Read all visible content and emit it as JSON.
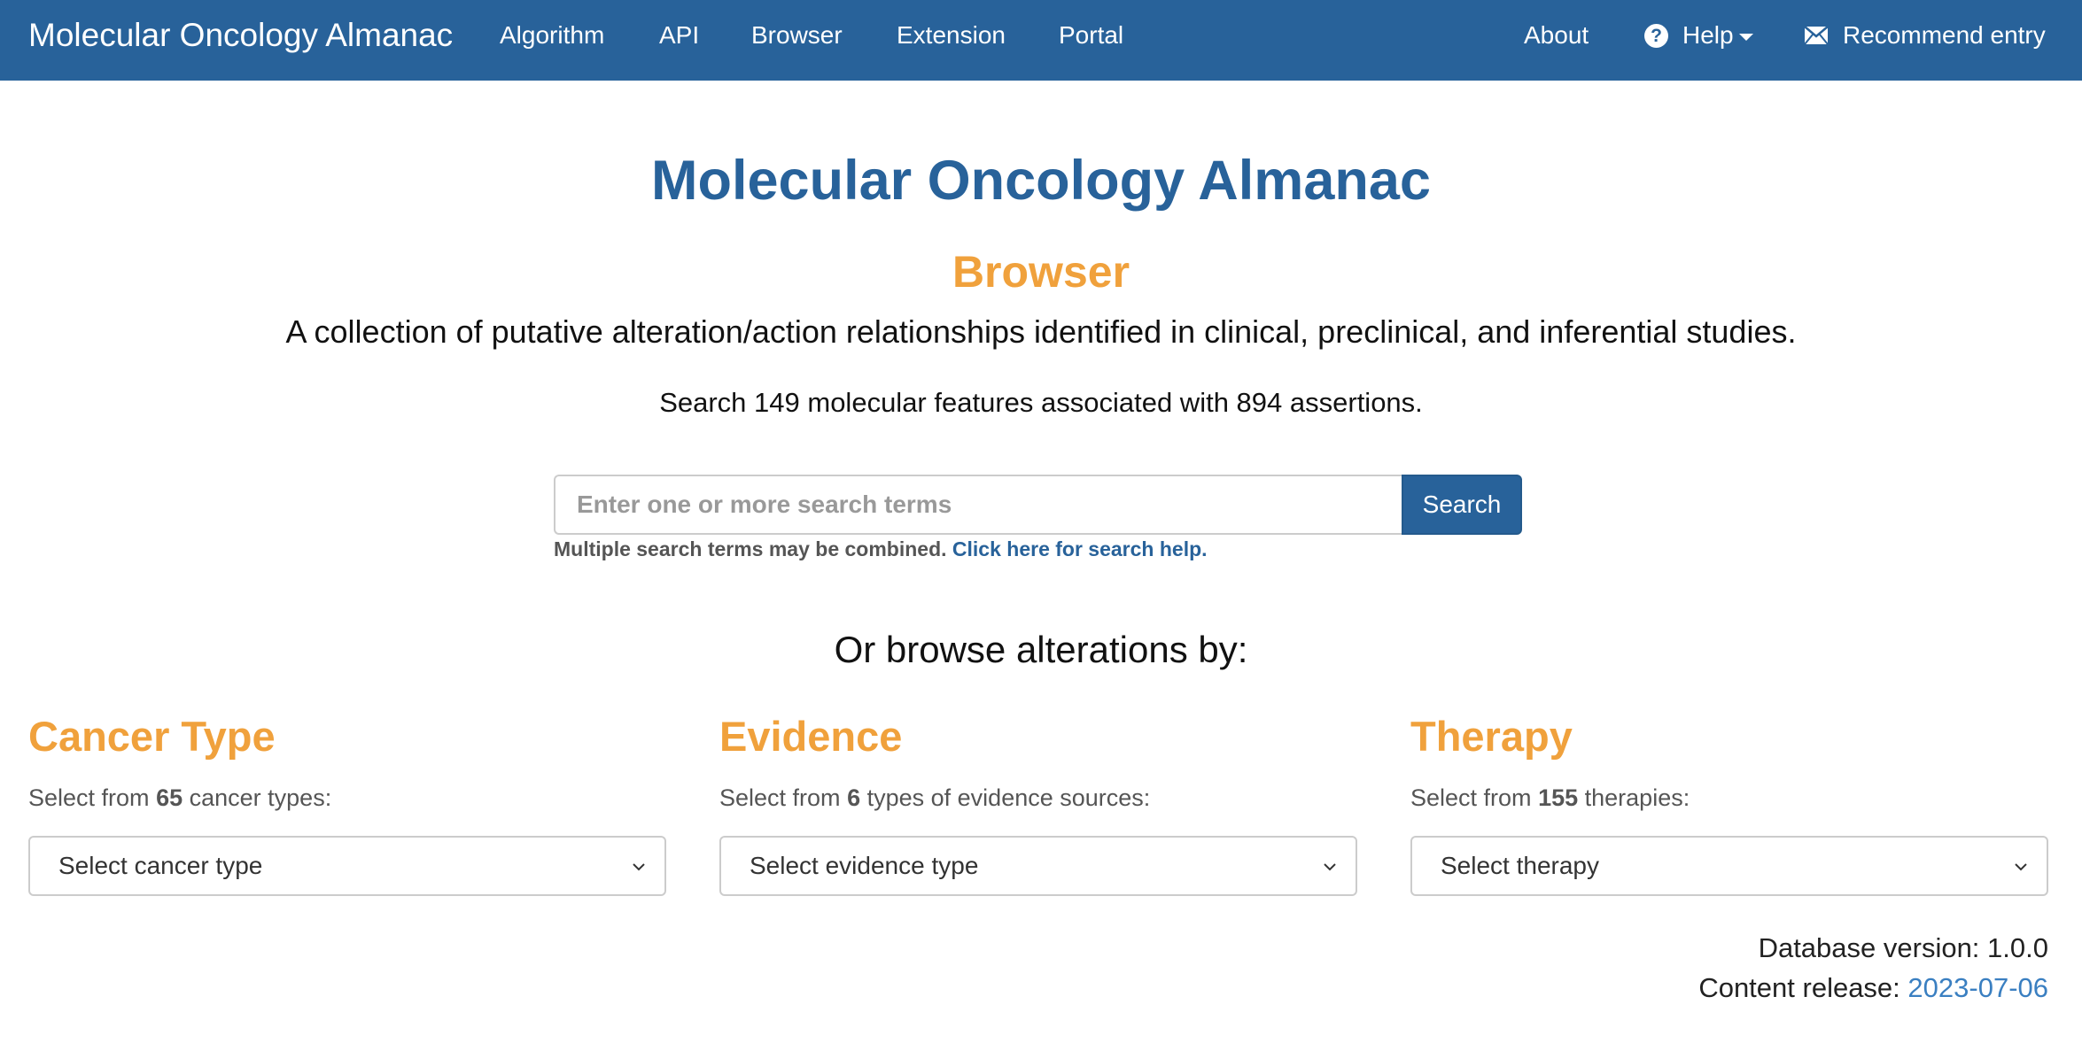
{
  "navbar": {
    "brand": "Molecular Oncology Almanac",
    "links": [
      "Algorithm",
      "API",
      "Browser",
      "Extension",
      "Portal"
    ],
    "about": "About",
    "help": "Help",
    "recommend": "Recommend entry"
  },
  "header": {
    "title": "Molecular Oncology Almanac",
    "subtitle": "Browser",
    "lead": "A collection of putative alteration/action relationships identified in clinical, preclinical, and inferential studies.",
    "stats": "Search 149 molecular features associated with 894 assertions."
  },
  "search": {
    "placeholder": "Enter one or more search terms",
    "button": "Search",
    "help_text": "Multiple search terms may be combined.",
    "help_link": "Click here for search help."
  },
  "browse": {
    "heading": "Or browse alterations by:",
    "columns": [
      {
        "title": "Cancer Type",
        "prefix": "Select from",
        "count": "65",
        "suffix": "cancer types:",
        "select": "Select cancer type"
      },
      {
        "title": "Evidence",
        "prefix": "Select from",
        "count": "6",
        "suffix": "types of evidence sources:",
        "select": "Select evidence type"
      },
      {
        "title": "Therapy",
        "prefix": "Select from",
        "count": "155",
        "suffix": "therapies:",
        "select": "Select therapy"
      }
    ]
  },
  "footer": {
    "db_version": "Database version: 1.0.0",
    "content_label": "Content release:",
    "content_date": "2023-07-06"
  },
  "colors": {
    "primary": "#28629a",
    "accent": "#f0a13c",
    "link": "#3a7fc1"
  }
}
